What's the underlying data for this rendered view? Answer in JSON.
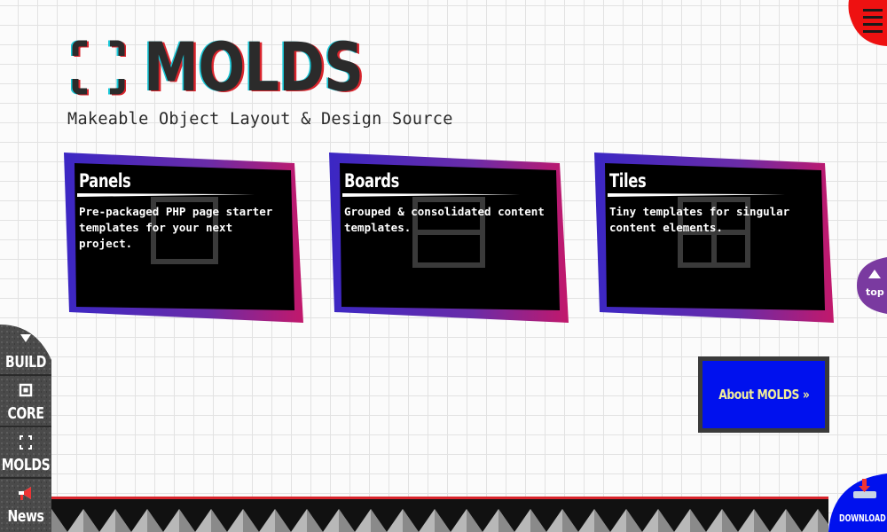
{
  "brand": {
    "name": "MOLDS",
    "tagline": "Makeable Object Layout & Design Source"
  },
  "cards": [
    {
      "title": "Panels",
      "description": "Pre-packaged PHP page starter templates for your next project.",
      "icon": "panel-icon"
    },
    {
      "title": "Boards",
      "description": "Grouped & consolidated content templates.",
      "icon": "board-icon"
    },
    {
      "title": "Tiles",
      "description": "Tiny templates for singular content elements.",
      "icon": "tiles-icon"
    }
  ],
  "about": {
    "label": "About MOLDS »"
  },
  "top_button": {
    "label": "top"
  },
  "download": {
    "label": "DOWNLOAD"
  },
  "side_nav": [
    {
      "label": "BUILD",
      "icon": "triangle-down-icon"
    },
    {
      "label": "CORE",
      "icon": "square-icon"
    },
    {
      "label": "MOLDS",
      "icon": "bracket-icon"
    },
    {
      "label": "News",
      "icon": "megaphone-icon"
    }
  ],
  "colors": {
    "accent_red": "#ee1111",
    "accent_purple": "#6a2ca8",
    "button_blue": "#0011ee",
    "button_text": "#f2ee9a",
    "card_bg": "#000000"
  }
}
